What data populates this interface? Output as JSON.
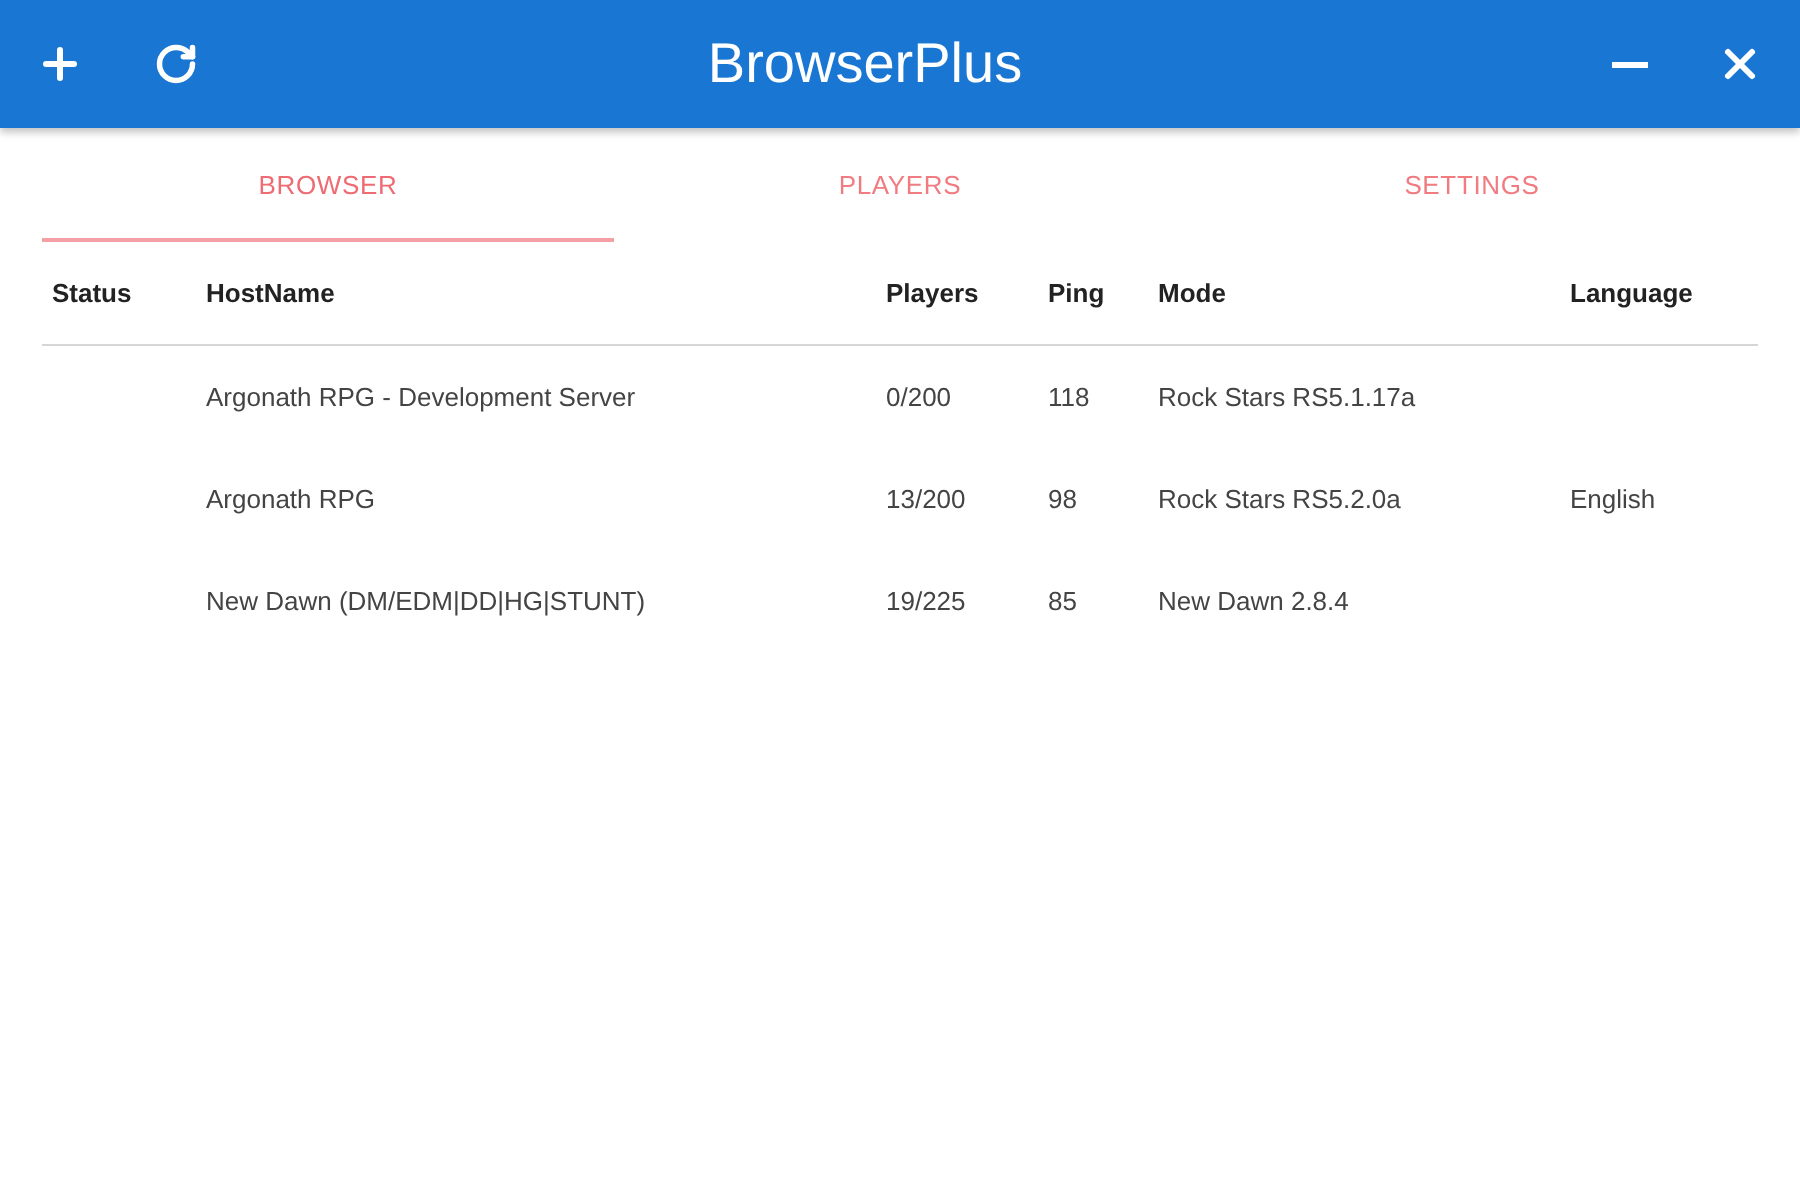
{
  "window": {
    "title": "BrowserPlus"
  },
  "tabs": [
    {
      "label": "BROWSER",
      "selected": true
    },
    {
      "label": "PLAYERS",
      "selected": false
    },
    {
      "label": "SETTINGS",
      "selected": false
    }
  ],
  "table": {
    "columns": [
      "Status",
      "HostName",
      "Players",
      "Ping",
      "Mode",
      "Language"
    ],
    "rows": [
      {
        "hostname": "Argonath RPG - Development Server",
        "players": "0/200",
        "ping": "118",
        "mode": "Rock Stars RS5.1.17a"
      },
      {
        "hostname": "Argonath RPG",
        "players": "13/200",
        "ping": "98",
        "mode": "Rock Stars RS5.2.0a",
        "language": "English"
      },
      {
        "hostname": "New Dawn (DM/EDM|DD|HG|STUNT)",
        "players": "19/225",
        "ping": "85",
        "mode": "New Dawn 2.8.4"
      }
    ]
  }
}
